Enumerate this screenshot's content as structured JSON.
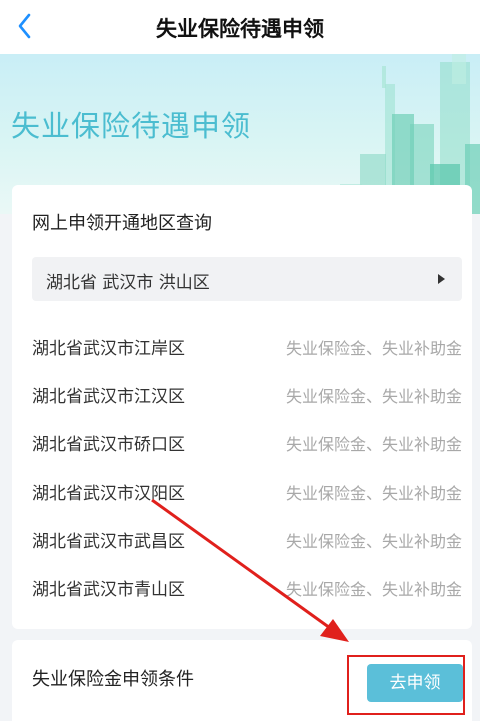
{
  "header": {
    "title": "失业保险待遇申领"
  },
  "banner": {
    "title": "失业保险待遇申领"
  },
  "query": {
    "title": "网上申领开通地区查询",
    "selected_region": "湖北省 武汉市 洪山区",
    "rows": [
      {
        "area": "湖北省武汉市江岸区",
        "type": "失业保险金、失业补助金"
      },
      {
        "area": "湖北省武汉市江汉区",
        "type": "失业保险金、失业补助金"
      },
      {
        "area": "湖北省武汉市硚口区",
        "type": "失业保险金、失业补助金"
      },
      {
        "area": "湖北省武汉市汉阳区",
        "type": "失业保险金、失业补助金"
      },
      {
        "area": "湖北省武汉市武昌区",
        "type": "失业保险金、失业补助金"
      },
      {
        "area": "湖北省武汉市青山区",
        "type": "失业保险金、失业补助金"
      }
    ]
  },
  "conditions": {
    "label": "失业保险金申领条件",
    "apply_label": "去申领"
  },
  "colors": {
    "accent": "#5bbfd9",
    "banner_text": "#4bbdd0",
    "annotation": "#e0201c"
  },
  "icons": {
    "back": "chevron-left-icon",
    "dropdown": "triangle-right-icon"
  }
}
